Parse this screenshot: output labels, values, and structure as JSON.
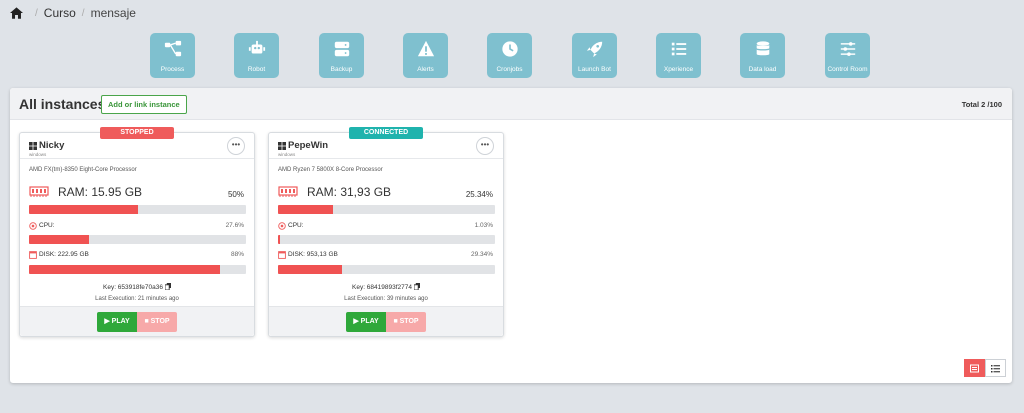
{
  "breadcrumb": {
    "items": [
      "Curso",
      "mensaje"
    ]
  },
  "tiles": [
    {
      "label": "Process",
      "icon": "process-icon"
    },
    {
      "label": "Robot",
      "icon": "robot-icon"
    },
    {
      "label": "Backup",
      "icon": "backup-icon"
    },
    {
      "label": "Alerts",
      "icon": "alert-icon"
    },
    {
      "label": "Cronjobs",
      "icon": "clock-icon"
    },
    {
      "label": "Launch Bot",
      "icon": "rocket-icon"
    },
    {
      "label": "Xperience",
      "icon": "list-icon"
    },
    {
      "label": "Data load",
      "icon": "database-icon"
    },
    {
      "label": "Control Room",
      "icon": "sliders-icon"
    }
  ],
  "panel": {
    "title": "All instances",
    "add_label": "Add or link instance",
    "total": "Total 2 /100"
  },
  "colors": {
    "tile": "#7fc0cf",
    "danger": "#ef5b5b",
    "success": "#2fa83a",
    "connected": "#1fb3ad"
  },
  "instances": [
    {
      "status": "STOPPED",
      "name": "Nicky",
      "os": "windows",
      "processor": "AMD FX(tm)-8350 Eight-Core Processor",
      "ram_label": "RAM: 15.95 GB",
      "ram_pct": "50%",
      "ram_fill": 0.5,
      "cpu_label": "CPU:",
      "cpu_pct": "27.6%",
      "cpu_fill": 0.276,
      "disk_label": "DISK: 222.95 GB",
      "disk_pct": "88%",
      "disk_fill": 0.88,
      "key": "Key: 653918fe70a36",
      "last_exec": "Last Execution: 21 minutes ago",
      "play": "PLAY",
      "stop": "STOP"
    },
    {
      "status": "CONNECTED",
      "name": "PepeWin",
      "os": "windows",
      "processor": "AMD Ryzen 7 5800X 8-Core Processor",
      "ram_label": "RAM: 31,93 GB",
      "ram_pct": "25.34%",
      "ram_fill": 0.2534,
      "cpu_label": "CPU:",
      "cpu_pct": "1.03%",
      "cpu_fill": 0.0103,
      "disk_label": "DISK: 953,13 GB",
      "disk_pct": "29.34%",
      "disk_fill": 0.2934,
      "key": "Key: 68419893f2774",
      "last_exec": "Last Execution: 39 minutes ago",
      "play": "PLAY",
      "stop": "STOP"
    }
  ]
}
